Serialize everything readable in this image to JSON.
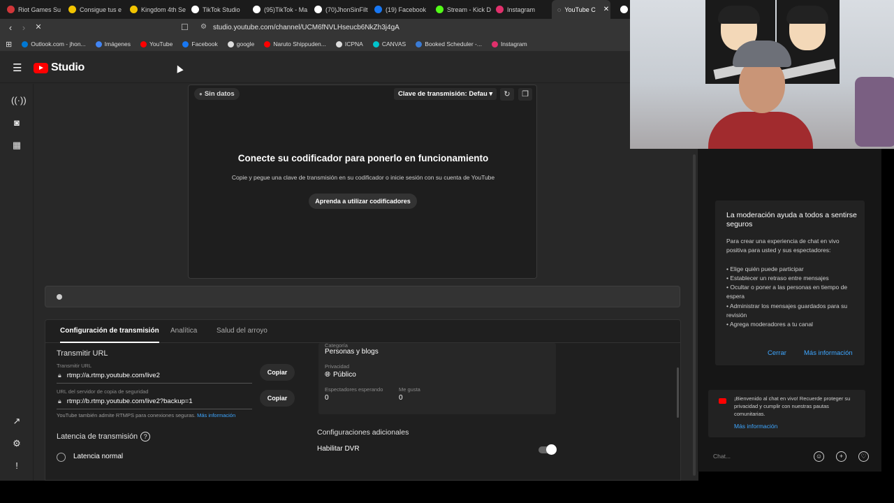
{
  "browser": {
    "tabs": [
      {
        "label": "Riot Games Su",
        "color": "#d13639"
      },
      {
        "label": "Consigue tus e",
        "color": "#f2c400"
      },
      {
        "label": "Kingdom 4th Se",
        "color": "#f2c400"
      },
      {
        "label": "TikTok Studio",
        "color": "#ffffff"
      },
      {
        "label": "(95)TikTok - Ma",
        "color": "#ffffff"
      },
      {
        "label": "(70)JhonSinFilt",
        "color": "#ffffff"
      },
      {
        "label": "(19) Facebook",
        "color": "#1877f2"
      },
      {
        "label": "Stream - Kick D",
        "color": "#53fc18"
      },
      {
        "label": "Instagram",
        "color": "#e1306c"
      }
    ],
    "active_tab": "YouTube C",
    "url": "studio.youtube.com/channel/UCM6fNVLHseucb6NkZh3j4gA",
    "bookmarks": [
      {
        "label": "Outlook.com - jhon...",
        "color": "#0078d4"
      },
      {
        "label": "Imágenes",
        "color": "#4285f4"
      },
      {
        "label": "YouTube",
        "color": "#ff0000"
      },
      {
        "label": "Facebook",
        "color": "#1877f2"
      },
      {
        "label": "google",
        "color": "#dddddd"
      },
      {
        "label": "Naruto Shippuden...",
        "color": "#ff0000"
      },
      {
        "label": "ICPNA",
        "color": "#dddddd"
      },
      {
        "label": "CANVAS",
        "color": "#00c4cc"
      },
      {
        "label": "Booked Scheduler -...",
        "color": "#3a7bd5"
      },
      {
        "label": "Instagram",
        "color": "#e1306c"
      }
    ]
  },
  "studio": {
    "logo_text": "Studio",
    "preview": {
      "status": "Sin datos",
      "stream_key": "Clave de transmisión: Defau",
      "title": "Conecte su codificador para ponerlo en funcionamiento",
      "subtitle": "Copie y pegue una clave de transmisión en su codificador o inicie sesión con su cuenta de YouTube",
      "button": "Aprenda a utilizar codificadores"
    },
    "tabs": [
      "Configuración de transmisión",
      "Analítica",
      "Salud del arroyo"
    ],
    "transmit": {
      "title": "Transmitir URL",
      "url_label": "Transmitir URL",
      "url_value": "rtmp://a.rtmp.youtube.com/live2",
      "backup_label": "URL del servidor de copia de seguridad",
      "backup_value": "rtmp://b.rtmp.youtube.com/live2?backup=1",
      "copy_label": "Copiar",
      "hint": "YouTube también admite RTMPS para conexiones seguras.",
      "hint_link": "Más información"
    },
    "latency": {
      "title": "Latencia de transmisión",
      "option": "Latencia normal"
    },
    "info": {
      "category_label": "Categoría",
      "category_value": "Personas y blogs",
      "privacy_label": "Privacidad",
      "privacy_value": "Público",
      "waiting_label": "Espectadores esperando",
      "waiting_value": "0",
      "likes_label": "Me gusta",
      "likes_value": "0"
    },
    "additional": {
      "title": "Configuraciones adicionales",
      "dvr_label": "Habilitar DVR",
      "dvr_enabled": true
    }
  },
  "chat": {
    "mod_title": "La moderación ayuda a todos a sentirse seguros",
    "mod_intro": "Para crear una experiencia de chat en vivo positiva para usted y sus espectadores:",
    "mod_items": [
      "• Elige quién puede participar",
      "• Establecer un retraso entre mensajes",
      "• Ocultar o poner a las personas en tiempo de espera",
      "• Administrar los mensajes guardados para su revisión",
      "• Agrega moderadores a tu canal"
    ],
    "close": "Cerrar",
    "more": "Más información",
    "welcome": "¡Bienvenido al chat en vivo! Recuerde proteger su privacidad y cumplir con nuestras pautas comunitarias.",
    "welcome_link": "Más información",
    "placeholder": "Chat..."
  }
}
